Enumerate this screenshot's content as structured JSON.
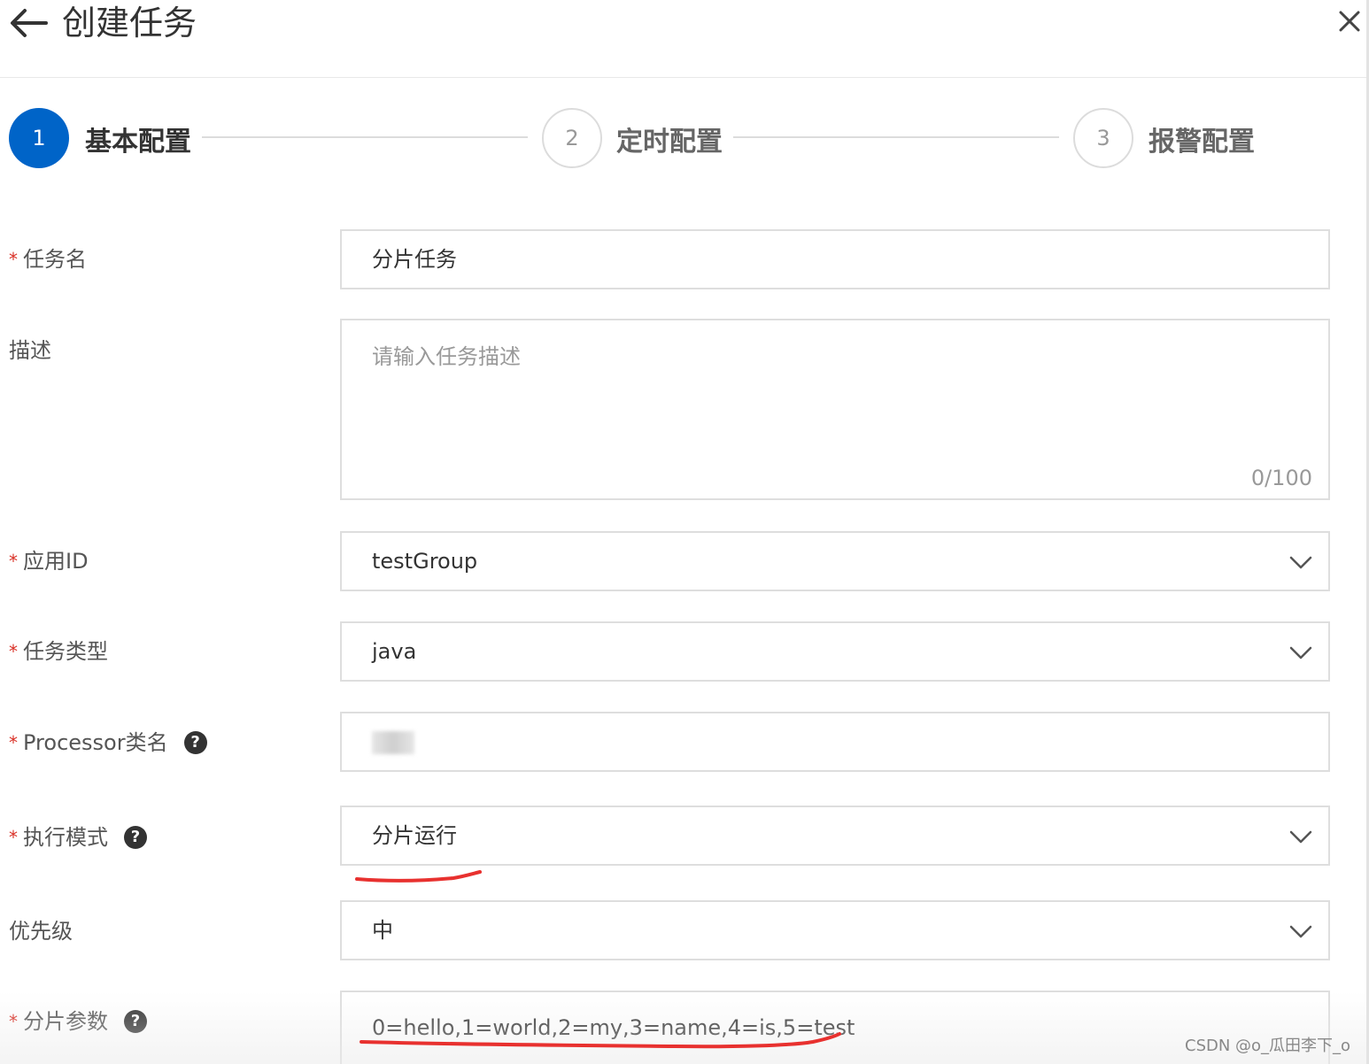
{
  "header": {
    "title": "创建任务",
    "back_icon": "arrow-left-icon",
    "close_icon": "close-icon"
  },
  "steps": [
    {
      "number": "1",
      "label": "基本配置",
      "state": "active"
    },
    {
      "number": "2",
      "label": "定时配置",
      "state": "inactive"
    },
    {
      "number": "3",
      "label": "报警配置",
      "state": "inactive"
    }
  ],
  "form": {
    "required_mark": "*",
    "task_name": {
      "label": "任务名",
      "value": "分片任务"
    },
    "description": {
      "label": "描述",
      "placeholder": "请输入任务描述",
      "counter": "0/100"
    },
    "app_id": {
      "label": "应用ID",
      "value": "testGroup"
    },
    "task_type": {
      "label": "任务类型",
      "value": "java"
    },
    "processor": {
      "label": "Processor类名",
      "help": "?"
    },
    "exec_mode": {
      "label": "执行模式",
      "value": "分片运行",
      "help": "?"
    },
    "priority": {
      "label": "优先级",
      "value": "中"
    },
    "shard_params": {
      "label": "分片参数",
      "value": "0=hello,1=world,2=my,3=name,4=is,5=test",
      "help": "?"
    }
  },
  "colors": {
    "primary": "#0064c8",
    "required": "#d93026",
    "annotation": "#e8312f"
  },
  "watermark": "CSDN @o_瓜田李下_o"
}
